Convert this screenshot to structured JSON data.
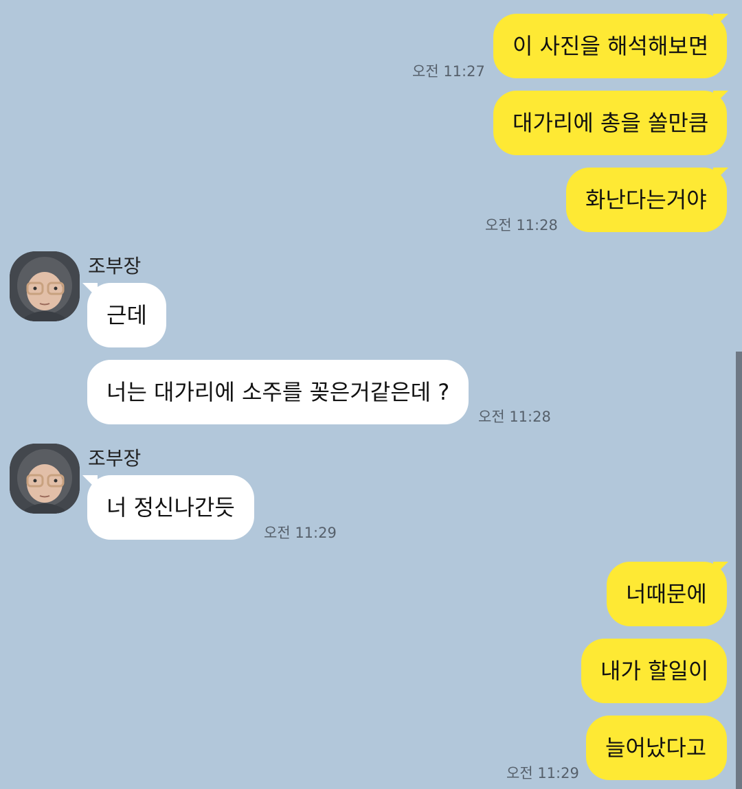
{
  "contact": {
    "name": "조부장"
  },
  "messages": [
    {
      "text": "이 사진을 해석해보면",
      "time": "오전 11:27"
    },
    {
      "text": "대가리에 총을 쏠만큼"
    },
    {
      "text": "화난다는거야",
      "time": "오전 11:28"
    },
    {
      "text": "근데"
    },
    {
      "text": "너는 대가리에 소주를 꽂은거같은데 ?",
      "time": "오전 11:28"
    },
    {
      "text": "너 정신나간듯",
      "time": "오전 11:29"
    },
    {
      "text": "너때문에"
    },
    {
      "text": "내가 할일이"
    },
    {
      "text": "늘어났다고",
      "time": "오전 11:29"
    }
  ],
  "colors": {
    "background": "#b2c7da",
    "my_bubble": "#fee934",
    "their_bubble": "#ffffff"
  }
}
